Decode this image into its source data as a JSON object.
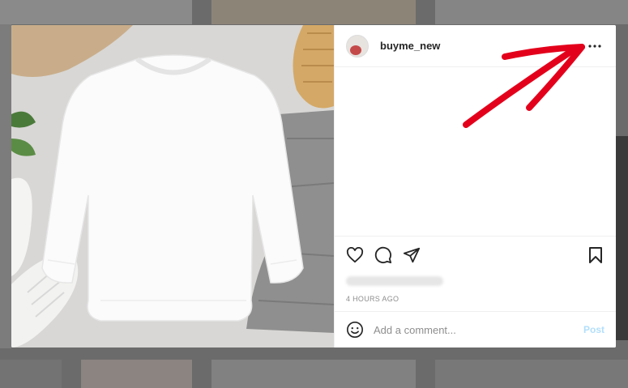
{
  "post": {
    "username": "buyme_new",
    "timestamp": "4 HOURS AGO",
    "comment_placeholder": "Add a comment...",
    "post_label": "Post"
  },
  "icons": {
    "more": "more-horizontal-icon",
    "like": "heart-icon",
    "comment": "comment-bubble-icon",
    "share": "paper-plane-icon",
    "save": "bookmark-icon",
    "emoji": "smiley-icon"
  },
  "colors": {
    "post_button": "#b2dffc",
    "annotation_arrow": "#e3001b",
    "text_primary": "#262626",
    "text_secondary": "#8e8e8e"
  }
}
